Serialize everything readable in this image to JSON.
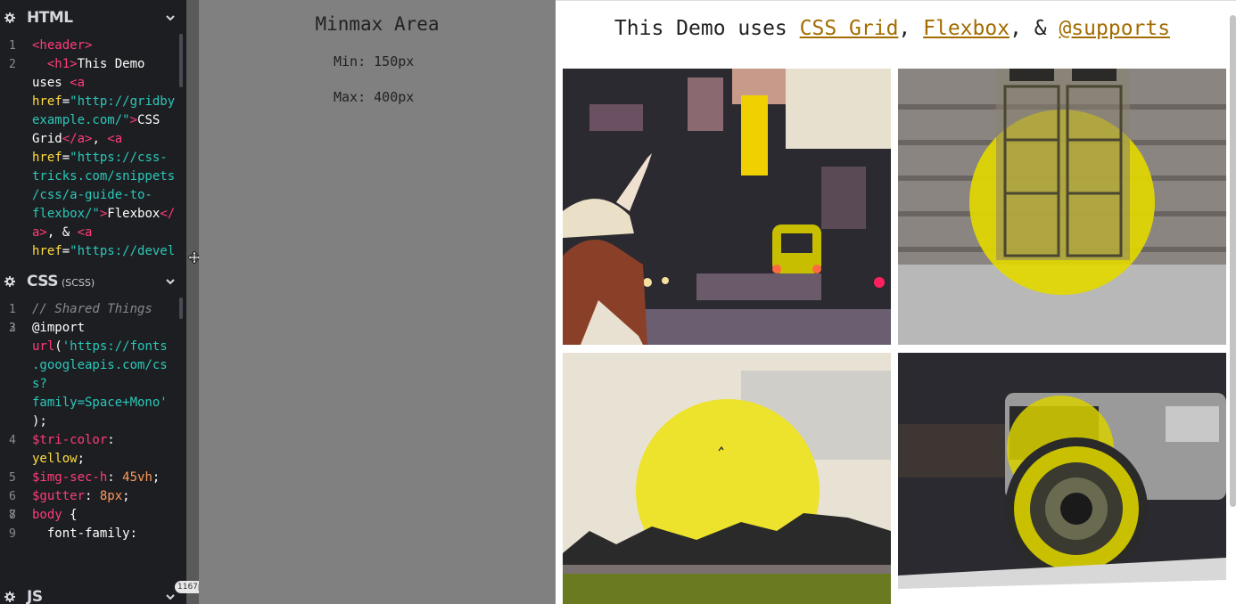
{
  "editor": {
    "html_pane": {
      "title": "HTML",
      "lines": [
        {
          "n": "1",
          "parts": [
            [
              "tag",
              "<header>"
            ]
          ]
        },
        {
          "n": "2",
          "parts": [
            [
              "plain",
              "  "
            ],
            [
              "tag",
              "<h1>"
            ],
            [
              "plain",
              "This Demo"
            ]
          ]
        },
        {
          "n": "",
          "parts": [
            [
              "plain",
              "uses "
            ],
            [
              "tag",
              "<a"
            ]
          ]
        },
        {
          "n": "",
          "parts": [
            [
              "attr",
              "href"
            ],
            [
              "plain",
              "="
            ],
            [
              "str",
              "\"http://gridby"
            ]
          ]
        },
        {
          "n": "",
          "parts": [
            [
              "str",
              "example.com/\""
            ],
            [
              "tag",
              ">"
            ],
            [
              "plain",
              "CSS"
            ]
          ]
        },
        {
          "n": "",
          "parts": [
            [
              "plain",
              "Grid"
            ],
            [
              "tag",
              "</a>"
            ],
            [
              "plain",
              ", "
            ],
            [
              "tag",
              "<a"
            ]
          ]
        },
        {
          "n": "",
          "parts": [
            [
              "attr",
              "href"
            ],
            [
              "plain",
              "="
            ],
            [
              "str",
              "\"https://css-"
            ]
          ]
        },
        {
          "n": "",
          "parts": [
            [
              "str",
              "tricks.com/snippets"
            ]
          ]
        },
        {
          "n": "",
          "parts": [
            [
              "str",
              "/css/a-guide-to-"
            ]
          ]
        },
        {
          "n": "",
          "parts": [
            [
              "str",
              "flexbox/\""
            ],
            [
              "tag",
              ">"
            ],
            [
              "plain",
              "Flexbox"
            ],
            [
              "tag",
              "</"
            ]
          ]
        },
        {
          "n": "",
          "parts": [
            [
              "tag",
              "a>"
            ],
            [
              "plain",
              ", & "
            ],
            [
              "tag",
              "<a"
            ]
          ]
        },
        {
          "n": "",
          "parts": [
            [
              "attr",
              "href"
            ],
            [
              "plain",
              "="
            ],
            [
              "str",
              "\"https://devel"
            ]
          ]
        }
      ]
    },
    "css_pane": {
      "title": "CSS",
      "subtitle": "(SCSS)",
      "lines": [
        {
          "n": "1",
          "parts": [
            [
              "cmt",
              "// Shared Things"
            ]
          ]
        },
        {
          "n": "2",
          "parts": []
        },
        {
          "n": "3",
          "parts": [
            [
              "plain",
              "@import"
            ]
          ]
        },
        {
          "n": "",
          "parts": [
            [
              "fn",
              "url"
            ],
            [
              "plain",
              "("
            ],
            [
              "str",
              "'https://fonts"
            ]
          ]
        },
        {
          "n": "",
          "parts": [
            [
              "str",
              ".googleapis.com/cs"
            ]
          ]
        },
        {
          "n": "",
          "parts": [
            [
              "str",
              "s?"
            ]
          ]
        },
        {
          "n": "",
          "parts": [
            [
              "str",
              "family=Space+Mono'"
            ]
          ]
        },
        {
          "n": "",
          "parts": [
            [
              "plain",
              ");"
            ]
          ]
        },
        {
          "n": "4",
          "parts": [
            [
              "var",
              "$tri-color"
            ],
            [
              "plain",
              ":"
            ]
          ]
        },
        {
          "n": "",
          "parts": [
            [
              "kw",
              "yellow"
            ],
            [
              "plain",
              ";"
            ]
          ]
        },
        {
          "n": "5",
          "parts": [
            [
              "var",
              "$img-sec-h"
            ],
            [
              "plain",
              ": "
            ],
            [
              "num-val",
              "45vh"
            ],
            [
              "plain",
              ";"
            ]
          ]
        },
        {
          "n": "6",
          "parts": [
            [
              "var",
              "$gutter"
            ],
            [
              "plain",
              ": "
            ],
            [
              "num-val",
              "8px"
            ],
            [
              "plain",
              ";"
            ]
          ]
        },
        {
          "n": "7",
          "parts": []
        },
        {
          "n": "8",
          "parts": [
            [
              "tag",
              "body"
            ],
            [
              "plain",
              " {"
            ]
          ]
        },
        {
          "n": "9",
          "parts": [
            [
              "plain",
              "  font-family:"
            ]
          ]
        }
      ]
    },
    "js_pane": {
      "title": "JS"
    },
    "width_badge": "1167px"
  },
  "minmax": {
    "title": "Minmax Area",
    "min": "Min: 150px",
    "max": "Max: 400px"
  },
  "preview": {
    "heading_prefix": "This Demo uses ",
    "links": [
      "CSS Grid",
      "Flexbox",
      "@supports"
    ],
    "sep1": ", ",
    "sep2": ", & ",
    "images": [
      "city-lights-photo",
      "wooden-door-photo",
      "sunset-field-photo",
      "camera-photo"
    ]
  }
}
